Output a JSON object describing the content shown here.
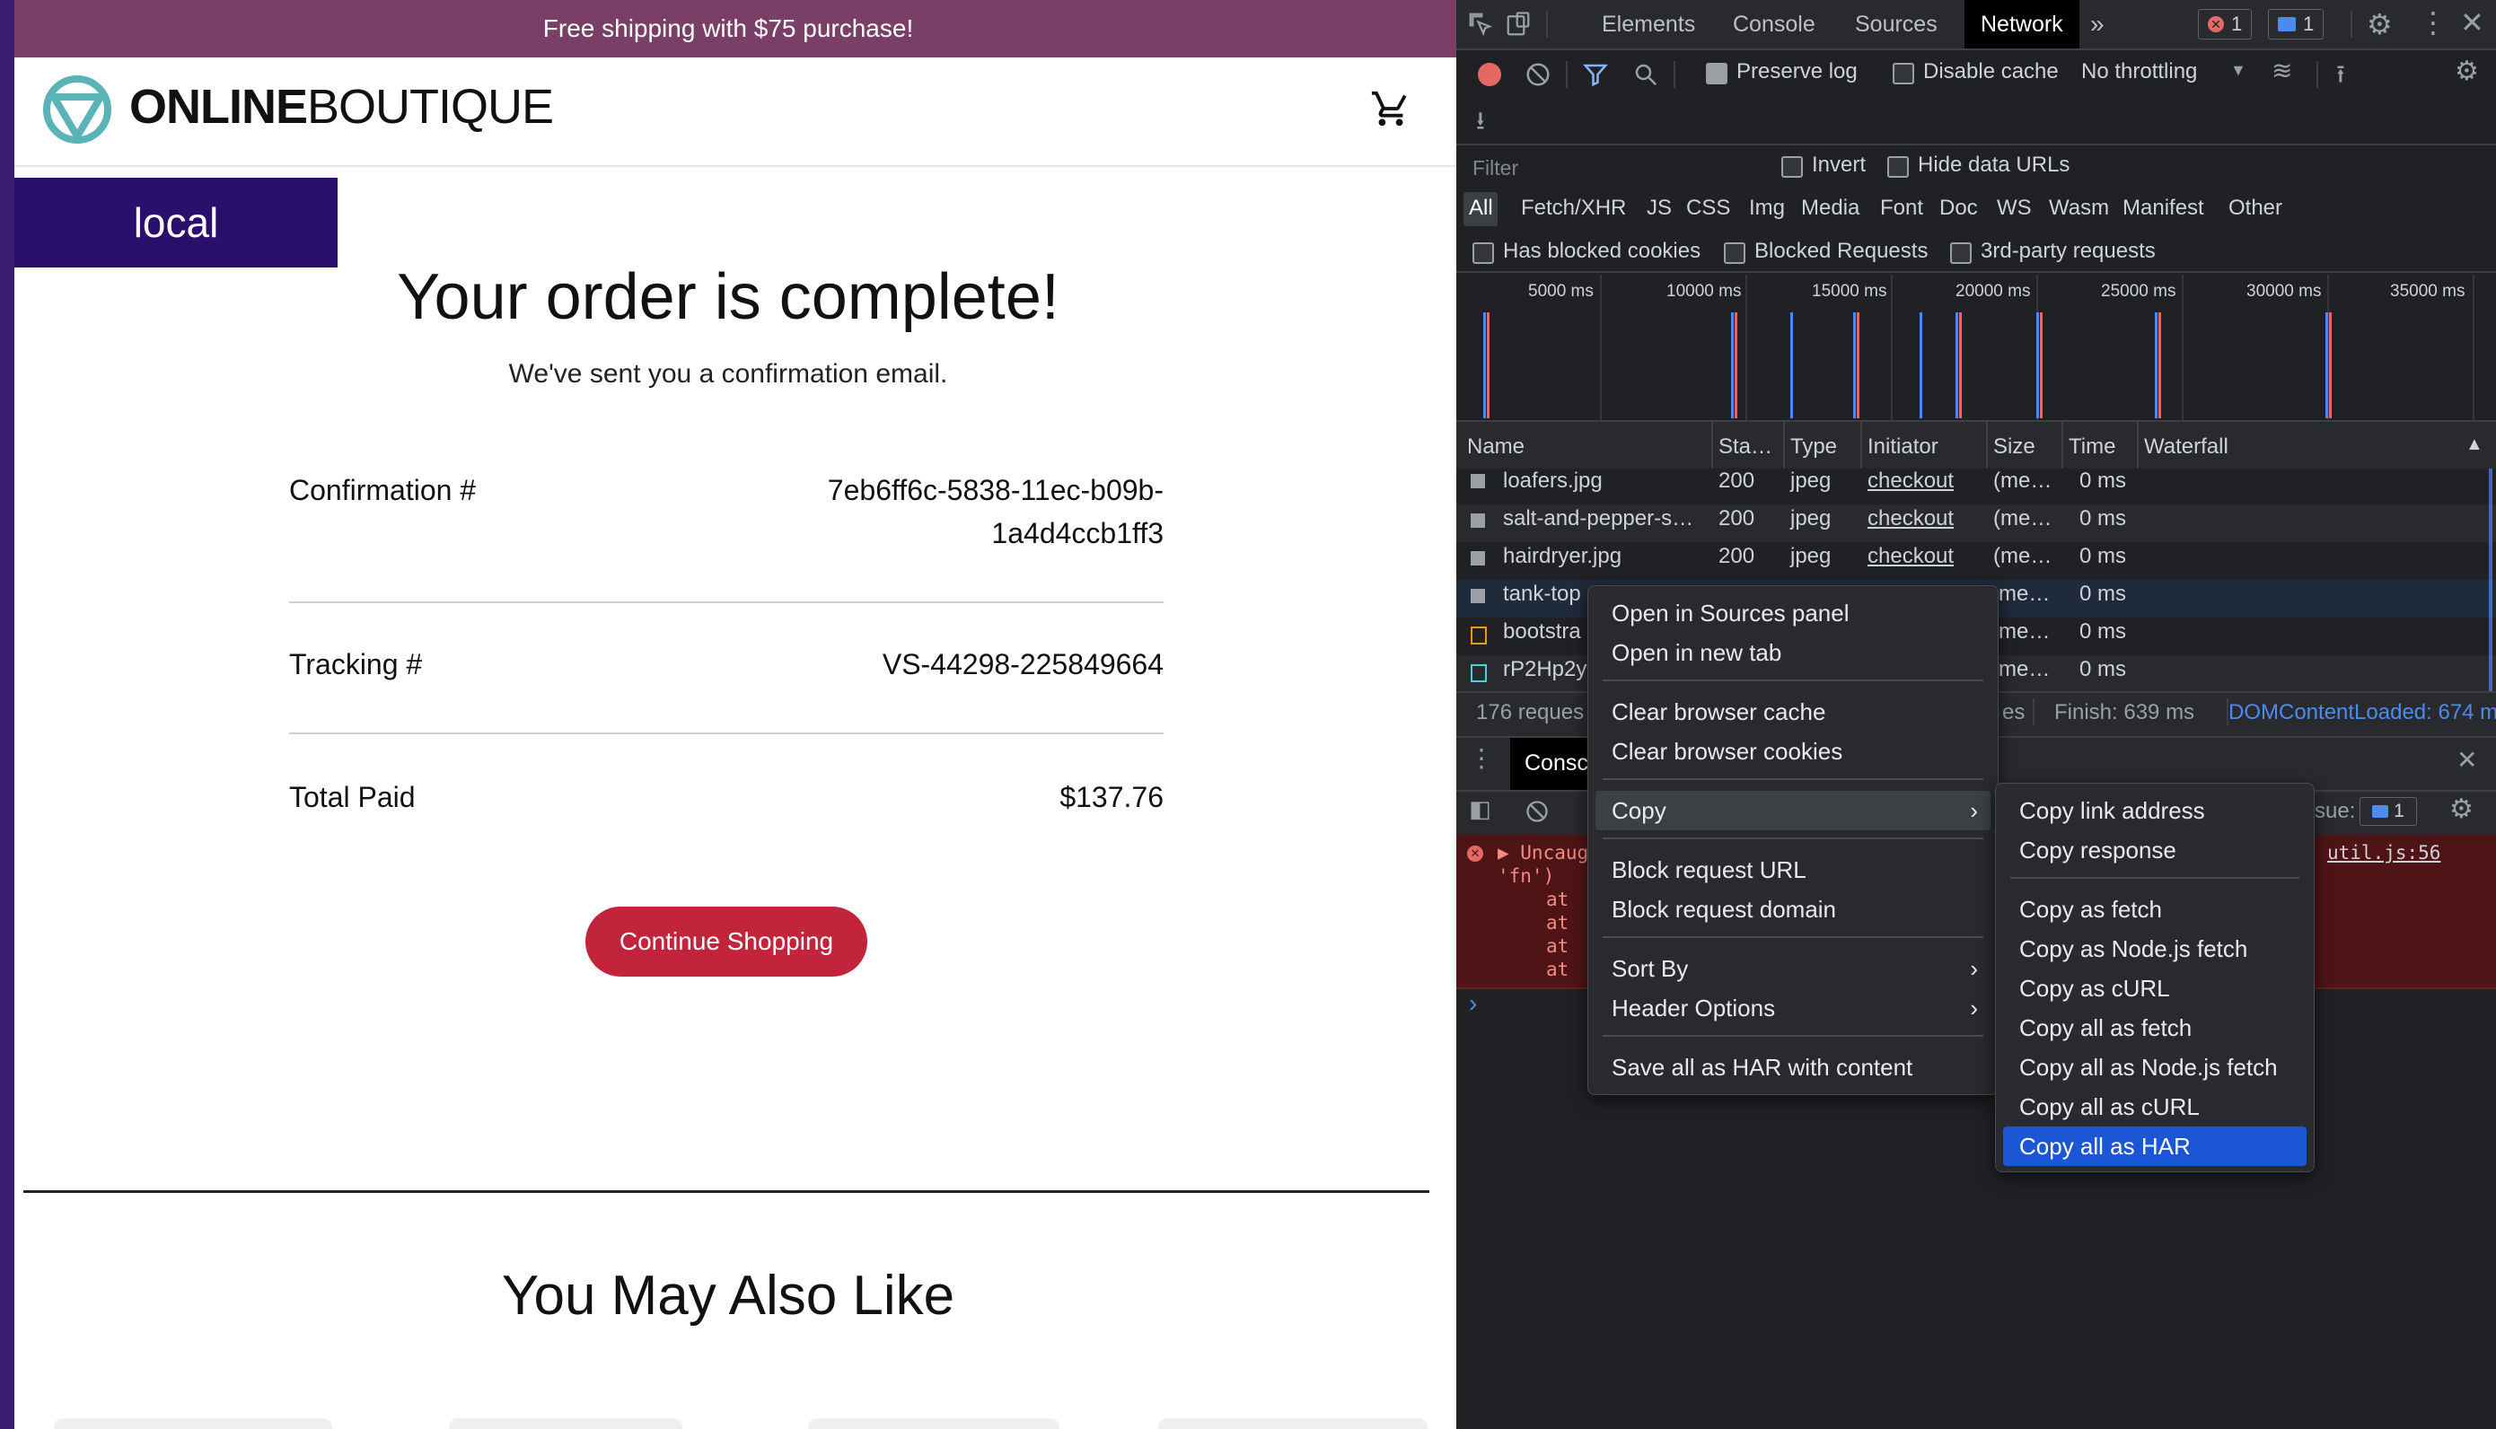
{
  "site": {
    "banner": "Free shipping with $75 purchase!",
    "logo_bold": "ONLINE",
    "logo_light": "BOUTIQUE",
    "env_label": "local",
    "heading": "Your order is complete!",
    "subheading": "We've sent you a confirmation email.",
    "rows": [
      {
        "label": "Confirmation #",
        "value_line1": "7eb6ff6c-5838-11ec-b09b-",
        "value_line2": "1a4d4ccb1ff3"
      },
      {
        "label": "Tracking #",
        "value_line1": "VS-44298-225849664"
      },
      {
        "label": "Total Paid",
        "value_line1": "$137.76"
      }
    ],
    "continue_button": "Continue Shopping",
    "also_like": "You May Also Like"
  },
  "devtools": {
    "tabs": [
      "Elements",
      "Console",
      "Sources",
      "Network"
    ],
    "active_tab": "Network",
    "more_tabs": "»",
    "error_count": "1",
    "message_count": "1",
    "toolbar": {
      "preserve_log": "Preserve log",
      "disable_cache": "Disable cache",
      "throttling": "No throttling"
    },
    "filter": {
      "placeholder": "Filter",
      "invert": "Invert",
      "hide_data_urls": "Hide data URLs",
      "types": [
        "All",
        "Fetch/XHR",
        "JS",
        "CSS",
        "Img",
        "Media",
        "Font",
        "Doc",
        "WS",
        "Wasm",
        "Manifest",
        "Other"
      ],
      "has_blocked_cookies": "Has blocked cookies",
      "blocked_requests": "Blocked Requests",
      "third_party": "3rd-party requests"
    },
    "timeline_ticks": [
      "5000 ms",
      "10000 ms",
      "15000 ms",
      "20000 ms",
      "25000 ms",
      "30000 ms",
      "35000 ms"
    ],
    "columns": [
      "Name",
      "Sta…",
      "Type",
      "Initiator",
      "Size",
      "Time",
      "Waterfall"
    ],
    "requests": [
      {
        "name": "loafers.jpg",
        "status": "200",
        "type": "jpeg",
        "initiator": "checkout",
        "size": "(me…",
        "time": "0 ms"
      },
      {
        "name": "salt-and-pepper-s…",
        "status": "200",
        "type": "jpeg",
        "initiator": "checkout",
        "size": "(me…",
        "time": "0 ms"
      },
      {
        "name": "hairdryer.jpg",
        "status": "200",
        "type": "jpeg",
        "initiator": "checkout",
        "size": "(me…",
        "time": "0 ms"
      },
      {
        "name": "tank-top",
        "status": "",
        "type": "",
        "initiator": "",
        "size": "me…",
        "time": "0 ms"
      },
      {
        "name": "bootstra",
        "status": "",
        "type": "",
        "initiator": "",
        "size": "me…",
        "time": "0 ms"
      },
      {
        "name": "rP2Hp2y",
        "status": "",
        "type": "",
        "initiator": "",
        "size": "me…",
        "time": "0 ms"
      }
    ],
    "status_bar": {
      "requests": "176 reques",
      "fragment": "es",
      "finish": "Finish: 639 ms",
      "dom_loaded": "DOMContentLoaded: 674 m"
    },
    "drawer": {
      "tab": "Consc",
      "issues": "sue:",
      "issues_count": "1",
      "error_line1": "▶ Uncaug",
      "error_line2": "'fn')",
      "at": [
        "at",
        "at",
        "at",
        "at"
      ],
      "source_link": "util.js:56",
      "prompt": "›"
    },
    "context_menu": {
      "items": [
        "Open in Sources panel",
        "Open in new tab",
        "Clear browser cache",
        "Clear browser cookies",
        "Copy",
        "Block request URL",
        "Block request domain",
        "Sort By",
        "Header Options",
        "Save all as HAR with content"
      ],
      "submenu_arrow": "›"
    },
    "copy_submenu": {
      "items": [
        "Copy link address",
        "Copy response",
        "Copy as fetch",
        "Copy as Node.js fetch",
        "Copy as cURL",
        "Copy all as fetch",
        "Copy all as Node.js fetch",
        "Copy all as cURL",
        "Copy all as HAR"
      ],
      "highlighted": "Copy all as HAR"
    },
    "colors": {
      "highlight": "#1a56d6",
      "active_tab_bg": "#000000",
      "button_red": "#c2253b"
    }
  }
}
